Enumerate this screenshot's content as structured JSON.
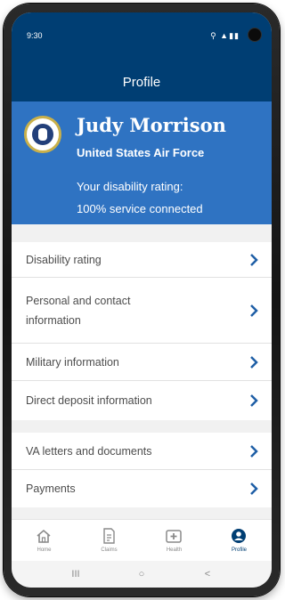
{
  "status_bar": {
    "time": "9:30",
    "icons": "⚲ ▲▮▮"
  },
  "app_bar": {
    "title": "Profile"
  },
  "profile": {
    "name": "Judy Morrison",
    "branch": "United States Air Force",
    "rating_label": "Your disability rating:",
    "rating_value": "100% service connected"
  },
  "menu": {
    "group_1": [
      {
        "label": "Disability rating"
      },
      {
        "label": "Personal and contact",
        "label_line2": "information"
      },
      {
        "label": "Military information"
      },
      {
        "label": "Direct deposit information"
      }
    ],
    "group_2": [
      {
        "label": "VA letters and documents"
      },
      {
        "label": "Payments"
      }
    ]
  },
  "bottom_nav": {
    "items": [
      {
        "label": "Home",
        "icon": "home-icon"
      },
      {
        "label": "Claims",
        "icon": "claims-icon"
      },
      {
        "label": "Health",
        "icon": "health-icon"
      },
      {
        "label": "Profile",
        "icon": "profile-icon",
        "active": true
      }
    ]
  },
  "system_nav": {
    "recents": "III",
    "home": "○",
    "back": "<"
  },
  "colors": {
    "header_navy": "#003e73",
    "profile_blue": "#2f73c2",
    "chevron_blue": "#1f5fa6",
    "text_gray": "#4d4d4d"
  }
}
